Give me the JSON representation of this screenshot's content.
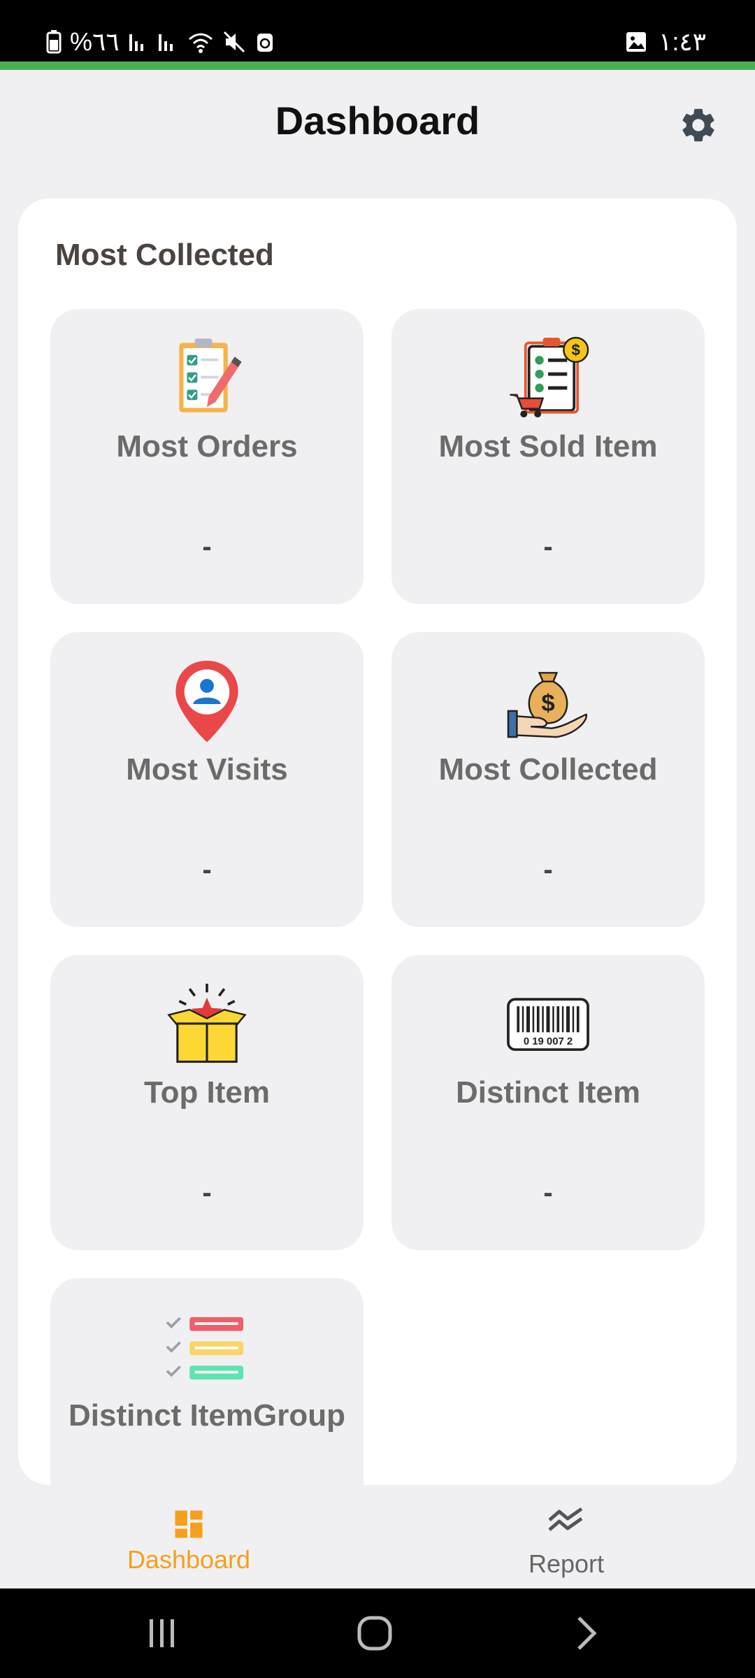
{
  "status_bar": {
    "battery_text": "%٦٦",
    "time": "١:٤٣"
  },
  "header": {
    "title": "Dashboard",
    "settings_icon": "gear-icon"
  },
  "section": {
    "title": "Most Collected"
  },
  "tiles": [
    {
      "label": "Most Orders",
      "value": "-",
      "icon": "clipboard-checklist-icon"
    },
    {
      "label": "Most Sold Item",
      "value": "-",
      "icon": "sales-checklist-icon"
    },
    {
      "label": "Most Visits",
      "value": "-",
      "icon": "location-pin-icon"
    },
    {
      "label": "Most Collected",
      "value": "-",
      "icon": "money-bag-hand-icon"
    },
    {
      "label": "Top Item",
      "value": "-",
      "icon": "open-box-star-icon"
    },
    {
      "label": "Distinct Item",
      "value": "-",
      "icon": "barcode-icon"
    },
    {
      "label": "Distinct ItemGroup",
      "value": "-",
      "icon": "checklist-bars-icon"
    }
  ],
  "bottom_nav": {
    "items": [
      {
        "label": "Dashboard",
        "active": true,
        "icon": "dashboard-icon"
      },
      {
        "label": "Report",
        "active": false,
        "icon": "chart-trend-icon"
      }
    ]
  },
  "colors": {
    "accent": "#f5a01a",
    "green_bar": "#4caf50"
  }
}
